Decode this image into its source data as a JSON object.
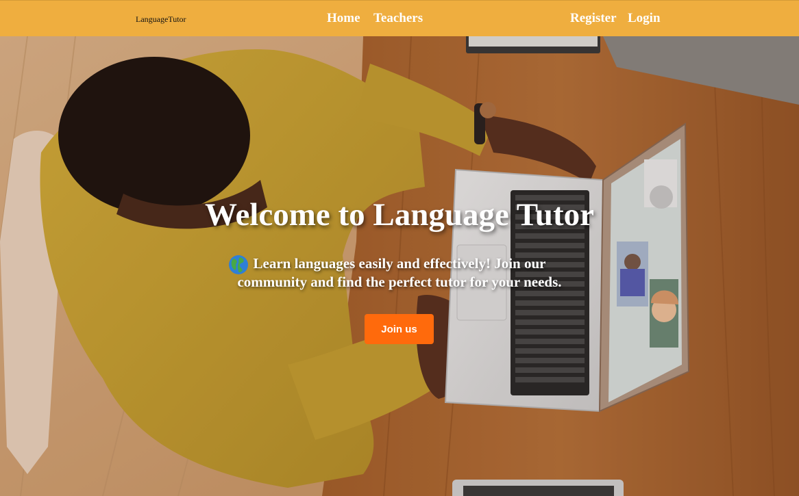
{
  "nav": {
    "brand": "LanguageTutor",
    "links": {
      "home": "Home",
      "teachers": "Teachers",
      "register": "Register",
      "login": "Login"
    }
  },
  "hero": {
    "title": "Welcome to Language Tutor",
    "subtitle": "Learn languages easily and effectively! Join our community and find the perfect tutor for your needs.",
    "globe_icon": "globe-icon",
    "cta_label": "Join us"
  },
  "colors": {
    "navbar_bg": "#efae3f",
    "nav_text": "#ffffff",
    "cta_bg": "#ff6a0c",
    "cta_text": "#ffffff"
  }
}
